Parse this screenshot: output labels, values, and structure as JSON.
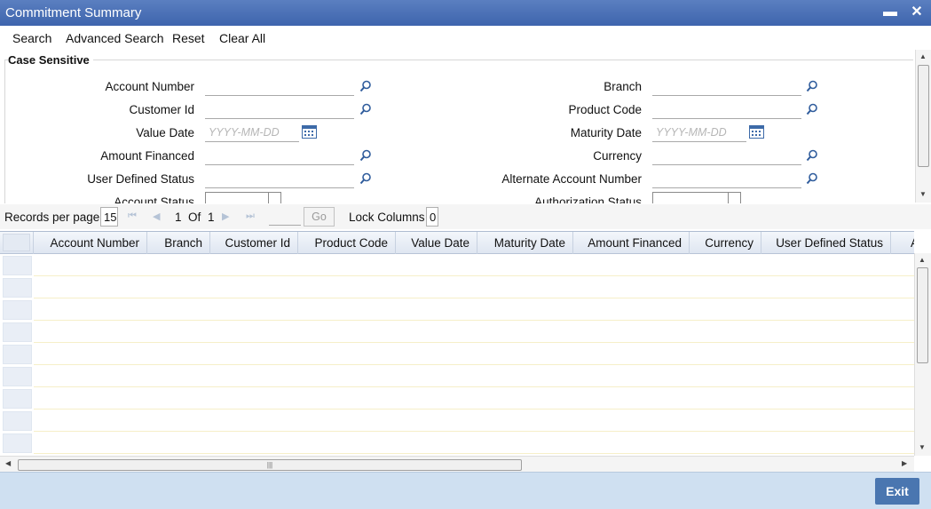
{
  "window": {
    "title": "Commitment Summary",
    "minimize": "▬",
    "close": "✕"
  },
  "toolbar": {
    "search": "Search",
    "advanced_search": "Advanced Search",
    "reset": "Reset",
    "clear_all": "Clear All"
  },
  "criteria": {
    "legend": "Case Sensitive",
    "left": {
      "account_number": "Account Number",
      "customer_id": "Customer Id",
      "value_date": "Value Date",
      "value_date_placeholder": "YYYY-MM-DD",
      "amount_financed": "Amount Financed",
      "user_defined_status": "User Defined Status",
      "account_status": "Account Status"
    },
    "right": {
      "branch": "Branch",
      "product_code": "Product Code",
      "maturity_date": "Maturity Date",
      "maturity_date_placeholder": "YYYY-MM-DD",
      "currency": "Currency",
      "alternate_account_number": "Alternate Account Number",
      "authorization_status": "Authorization Status"
    }
  },
  "pager": {
    "records_per_page_label": "Records per page",
    "records_per_page": "15",
    "current_page": "1",
    "of_label": "Of",
    "total_pages": "1",
    "go_label": "Go",
    "lock_columns_label": "Lock Columns",
    "lock_columns": "0"
  },
  "grid": {
    "columns": [
      "Account Number",
      "Branch",
      "Customer Id",
      "Product Code",
      "Value Date",
      "Maturity Date",
      "Amount Financed",
      "Currency",
      "User Defined Status",
      "A"
    ]
  },
  "footer": {
    "exit_label": "Exit"
  },
  "colors": {
    "title_bar": "#3e64ad",
    "footer": "#cfe0f1",
    "exit_button": "#4a76b0"
  }
}
